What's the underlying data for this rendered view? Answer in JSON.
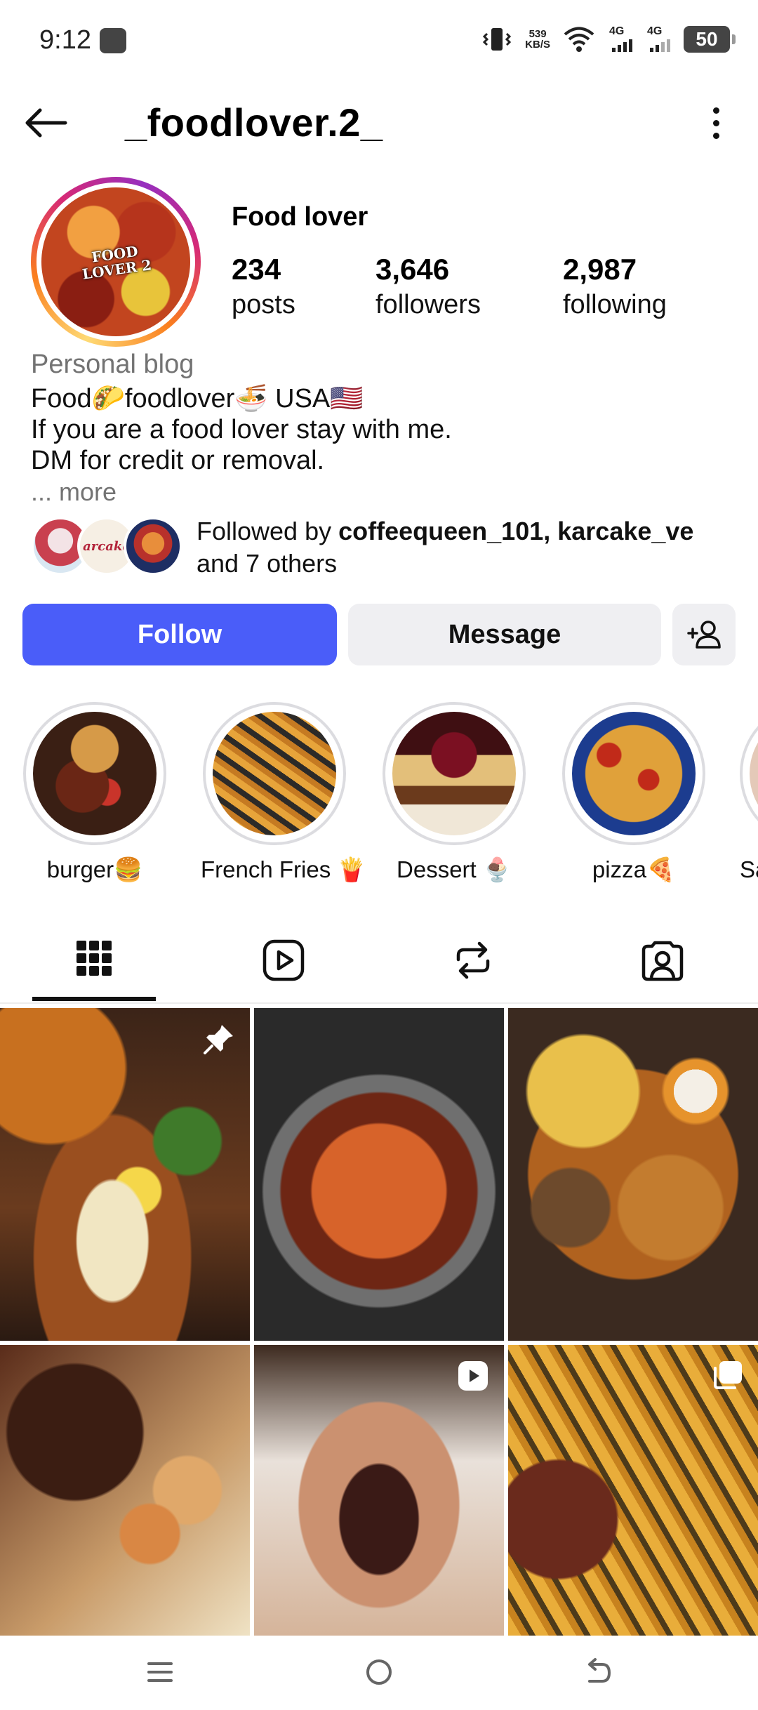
{
  "status_bar": {
    "time": "9:12",
    "speed_value": "539",
    "speed_unit": "KB/S",
    "network_1": "4G",
    "network_2": "4G",
    "battery": "50"
  },
  "header": {
    "username": "_foodlover.2_"
  },
  "profile": {
    "avatar_text_1": "FOOD",
    "avatar_text_2": "LOVER 2",
    "display_name": "Food lover",
    "stats": {
      "posts_count": "234",
      "posts_label": "posts",
      "followers_count": "3,646",
      "followers_label": "followers",
      "following_count": "2,987",
      "following_label": "following"
    },
    "category": "Personal blog",
    "bio_lines": [
      "Food🌮foodlover🍜 USA🇺🇸",
      "If you are a food lover stay with me.",
      "DM for credit or removal."
    ],
    "more": "... more",
    "followed_by_prefix": "Followed by ",
    "followed_by_names": "coffeequeen_101, karcake_ve",
    "followed_by_suffix": "and 7 others",
    "mini_avatar_text": "arcake"
  },
  "actions": {
    "follow": "Follow",
    "message": "Message"
  },
  "highlights": [
    {
      "label": "burger🍔"
    },
    {
      "label": "French Fries 🍟"
    },
    {
      "label": "Dessert 🍨"
    },
    {
      "label": "pizza🍕"
    },
    {
      "label": "Sa"
    }
  ],
  "tabs": [
    "grid-icon",
    "reels-icon",
    "reposts-icon",
    "tagged-icon"
  ],
  "colors": {
    "follow_button": "#4a5df9",
    "secondary_button": "#efeff2",
    "muted_text": "#737373"
  }
}
